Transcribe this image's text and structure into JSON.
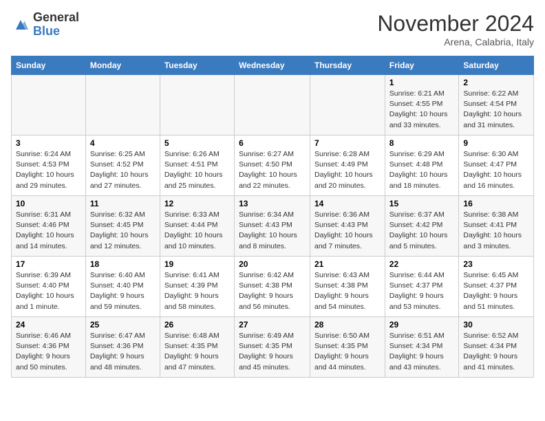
{
  "header": {
    "logo_general": "General",
    "logo_blue": "Blue",
    "month_title": "November 2024",
    "location": "Arena, Calabria, Italy"
  },
  "days_of_week": [
    "Sunday",
    "Monday",
    "Tuesday",
    "Wednesday",
    "Thursday",
    "Friday",
    "Saturday"
  ],
  "weeks": [
    [
      {
        "num": "",
        "detail": ""
      },
      {
        "num": "",
        "detail": ""
      },
      {
        "num": "",
        "detail": ""
      },
      {
        "num": "",
        "detail": ""
      },
      {
        "num": "",
        "detail": ""
      },
      {
        "num": "1",
        "detail": "Sunrise: 6:21 AM\nSunset: 4:55 PM\nDaylight: 10 hours and 33 minutes."
      },
      {
        "num": "2",
        "detail": "Sunrise: 6:22 AM\nSunset: 4:54 PM\nDaylight: 10 hours and 31 minutes."
      }
    ],
    [
      {
        "num": "3",
        "detail": "Sunrise: 6:24 AM\nSunset: 4:53 PM\nDaylight: 10 hours and 29 minutes."
      },
      {
        "num": "4",
        "detail": "Sunrise: 6:25 AM\nSunset: 4:52 PM\nDaylight: 10 hours and 27 minutes."
      },
      {
        "num": "5",
        "detail": "Sunrise: 6:26 AM\nSunset: 4:51 PM\nDaylight: 10 hours and 25 minutes."
      },
      {
        "num": "6",
        "detail": "Sunrise: 6:27 AM\nSunset: 4:50 PM\nDaylight: 10 hours and 22 minutes."
      },
      {
        "num": "7",
        "detail": "Sunrise: 6:28 AM\nSunset: 4:49 PM\nDaylight: 10 hours and 20 minutes."
      },
      {
        "num": "8",
        "detail": "Sunrise: 6:29 AM\nSunset: 4:48 PM\nDaylight: 10 hours and 18 minutes."
      },
      {
        "num": "9",
        "detail": "Sunrise: 6:30 AM\nSunset: 4:47 PM\nDaylight: 10 hours and 16 minutes."
      }
    ],
    [
      {
        "num": "10",
        "detail": "Sunrise: 6:31 AM\nSunset: 4:46 PM\nDaylight: 10 hours and 14 minutes."
      },
      {
        "num": "11",
        "detail": "Sunrise: 6:32 AM\nSunset: 4:45 PM\nDaylight: 10 hours and 12 minutes."
      },
      {
        "num": "12",
        "detail": "Sunrise: 6:33 AM\nSunset: 4:44 PM\nDaylight: 10 hours and 10 minutes."
      },
      {
        "num": "13",
        "detail": "Sunrise: 6:34 AM\nSunset: 4:43 PM\nDaylight: 10 hours and 8 minutes."
      },
      {
        "num": "14",
        "detail": "Sunrise: 6:36 AM\nSunset: 4:43 PM\nDaylight: 10 hours and 7 minutes."
      },
      {
        "num": "15",
        "detail": "Sunrise: 6:37 AM\nSunset: 4:42 PM\nDaylight: 10 hours and 5 minutes."
      },
      {
        "num": "16",
        "detail": "Sunrise: 6:38 AM\nSunset: 4:41 PM\nDaylight: 10 hours and 3 minutes."
      }
    ],
    [
      {
        "num": "17",
        "detail": "Sunrise: 6:39 AM\nSunset: 4:40 PM\nDaylight: 10 hours and 1 minute."
      },
      {
        "num": "18",
        "detail": "Sunrise: 6:40 AM\nSunset: 4:40 PM\nDaylight: 9 hours and 59 minutes."
      },
      {
        "num": "19",
        "detail": "Sunrise: 6:41 AM\nSunset: 4:39 PM\nDaylight: 9 hours and 58 minutes."
      },
      {
        "num": "20",
        "detail": "Sunrise: 6:42 AM\nSunset: 4:38 PM\nDaylight: 9 hours and 56 minutes."
      },
      {
        "num": "21",
        "detail": "Sunrise: 6:43 AM\nSunset: 4:38 PM\nDaylight: 9 hours and 54 minutes."
      },
      {
        "num": "22",
        "detail": "Sunrise: 6:44 AM\nSunset: 4:37 PM\nDaylight: 9 hours and 53 minutes."
      },
      {
        "num": "23",
        "detail": "Sunrise: 6:45 AM\nSunset: 4:37 PM\nDaylight: 9 hours and 51 minutes."
      }
    ],
    [
      {
        "num": "24",
        "detail": "Sunrise: 6:46 AM\nSunset: 4:36 PM\nDaylight: 9 hours and 50 minutes."
      },
      {
        "num": "25",
        "detail": "Sunrise: 6:47 AM\nSunset: 4:36 PM\nDaylight: 9 hours and 48 minutes."
      },
      {
        "num": "26",
        "detail": "Sunrise: 6:48 AM\nSunset: 4:35 PM\nDaylight: 9 hours and 47 minutes."
      },
      {
        "num": "27",
        "detail": "Sunrise: 6:49 AM\nSunset: 4:35 PM\nDaylight: 9 hours and 45 minutes."
      },
      {
        "num": "28",
        "detail": "Sunrise: 6:50 AM\nSunset: 4:35 PM\nDaylight: 9 hours and 44 minutes."
      },
      {
        "num": "29",
        "detail": "Sunrise: 6:51 AM\nSunset: 4:34 PM\nDaylight: 9 hours and 43 minutes."
      },
      {
        "num": "30",
        "detail": "Sunrise: 6:52 AM\nSunset: 4:34 PM\nDaylight: 9 hours and 41 minutes."
      }
    ]
  ]
}
